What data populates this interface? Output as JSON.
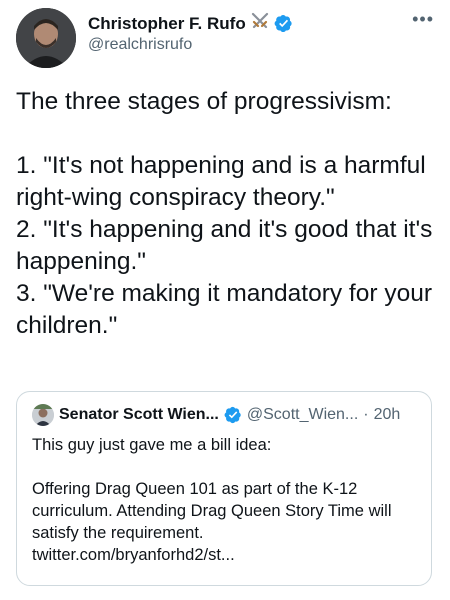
{
  "tweet": {
    "display_name": "Christopher F. Rufo",
    "handle": "@realchrisrufo",
    "badge_icon": "crossed-swords-icon",
    "verified_icon": "verified-badge-icon",
    "more_icon": "more-options-icon",
    "more_glyph": "•••",
    "text": "The three stages of progressivism:\n\n1. \"It's not happening and is a harmful right-wing conspiracy theory.\"\n2. \"It's happening and it's good that it's happening.\"\n3. \"We're making it mandatory for your children.\""
  },
  "quoted_tweet": {
    "display_name": "Senator Scott Wien...",
    "handle": "@Scott_Wien...",
    "separator": "·",
    "time": "20h",
    "verified_icon": "verified-badge-icon",
    "text": "This guy just gave me a bill idea:\n\nOffering Drag Queen 101 as part of the K-12 curriculum. Attending Drag Queen Story Time will satisfy the requirement.\ntwitter.com/bryanforhd2/st..."
  },
  "colors": {
    "verified": "#1d9bf0",
    "secondary_text": "#536471",
    "primary_text": "#0f1419",
    "border": "#cfd9de"
  }
}
